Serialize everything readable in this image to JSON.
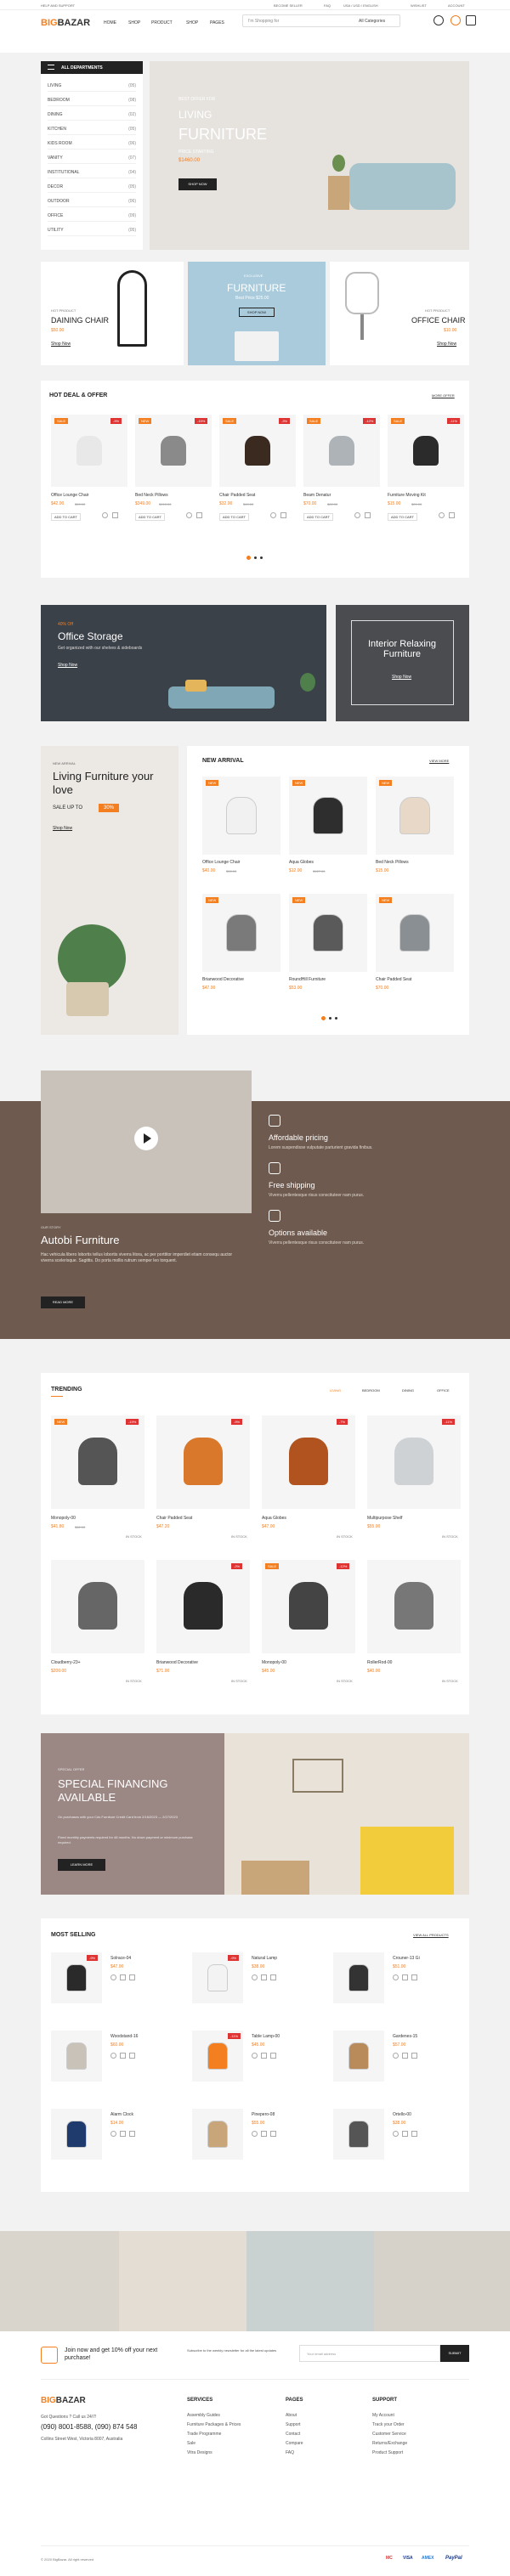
{
  "topbar": {
    "help": "HELP AND SUPPORT",
    "links": [
      "BECOME SELLER",
      "FAQ",
      "USA / USD / ENGLISH",
      "WISHLIST",
      "ACCOUNT"
    ]
  },
  "header": {
    "logo_a": "BIG",
    "logo_b": "BAZAR",
    "nav": [
      "HOME",
      "SHOP",
      "PRODUCT",
      "SHOP",
      "PAGES"
    ],
    "search_placeholder": "I'm Shopping for",
    "category": "All Categories"
  },
  "departments": {
    "title": "ALL DEPARTMENTS",
    "items": [
      {
        "name": "LIVING",
        "count": "(05)"
      },
      {
        "name": "BEDROOM",
        "count": "(08)"
      },
      {
        "name": "DINING",
        "count": "(02)"
      },
      {
        "name": "KITCHEN",
        "count": "(05)"
      },
      {
        "name": "KIDS ROOM",
        "count": "(06)"
      },
      {
        "name": "VANITY",
        "count": "(07)"
      },
      {
        "name": "INSTITUTIONAL",
        "count": "(04)"
      },
      {
        "name": "DECOR",
        "count": "(05)"
      },
      {
        "name": "OUTDOOR",
        "count": "(06)"
      },
      {
        "name": "OFFICE",
        "count": "(09)"
      },
      {
        "name": "UTILITY",
        "count": "(05)"
      }
    ]
  },
  "hero": {
    "kicker": "BEST OFFER FOR",
    "t1": "LIVING",
    "t2": "FURNITURE",
    "price_label": "PRICE STARTING",
    "price": "$1460.00",
    "btn": "SHOP NOW"
  },
  "promo3": [
    {
      "kicker": "HOT PRODUCT",
      "title": "DAINING CHAIR",
      "price": "$50.00",
      "link": "Shop Now"
    },
    {
      "kicker": "EXCLUSIVE",
      "title": "FURNITURE",
      "sub": "Best Price $25.00",
      "link": "SHOP NOW"
    },
    {
      "kicker": "HOT PRODUCT",
      "title": "OFFICE CHAIR",
      "price": "$10.00",
      "link": "Shop Now"
    }
  ],
  "hotdeal": {
    "title": "HOT DEAL & OFFER",
    "more": "MORE OFFER",
    "add": "ADD TO CART",
    "products": [
      {
        "name": "Office Lounge Chair",
        "price": "$42.00",
        "old": "$50.00",
        "tag": "SALE",
        "disc": "-9%"
      },
      {
        "name": "Bed Neck Pillows",
        "price": "$349.00",
        "old": "$410.00",
        "tag": "NEW",
        "disc": "-15%"
      },
      {
        "name": "Chair Padded Seat",
        "price": "$32.00",
        "old": "$40.00",
        "tag": "SALE",
        "disc": "-3%"
      },
      {
        "name": "Beam Denatur",
        "price": "$70.00",
        "old": "$80.00",
        "tag": "SALE",
        "disc": "-12%"
      },
      {
        "name": "Furniture Moving Kit",
        "price": "$15.00",
        "old": "$21.00",
        "tag": "SALE",
        "disc": "-11%"
      }
    ]
  },
  "banner2": [
    {
      "kicker": "40% Off",
      "title": "Office Storage",
      "sub": "Get organized with our shelves & sideboards",
      "link": "Shop Now"
    },
    {
      "title": "Interior Relaxing Furniture",
      "link": "Shop Now"
    }
  ],
  "arrival_promo": {
    "kicker": "NEW ARRIVAL",
    "title": "Living Furniture your love",
    "sale": "SALE UP TO",
    "pct": "30%",
    "link": "Shop Now"
  },
  "arrivals": {
    "title": "NEW ARRIVAL",
    "more": "VIEW MORE",
    "items": [
      {
        "name": "Office Lounge Chair",
        "price": "$40.00",
        "old": "$55.00",
        "tag": "NEW"
      },
      {
        "name": "Aqua Globes",
        "price": "$12.00",
        "old": "$127.00",
        "tag": "NEW"
      },
      {
        "name": "Bed Neck Pillows",
        "price": "$15.00",
        "old": "",
        "tag": "NEW"
      },
      {
        "name": "Brianwood Decorative",
        "price": "$47.00",
        "old": "",
        "tag": "NEW"
      },
      {
        "name": "RoundHill Furniture",
        "price": "$53.00",
        "old": "",
        "tag": "NEW"
      },
      {
        "name": "Chair Padded Seat",
        "price": "$70.00",
        "old": "",
        "tag": "NEW"
      }
    ]
  },
  "story": {
    "kicker": "OUR STORY",
    "title": "Autobi Furniture",
    "text": "Hac vehicula libero lobortis tellus lobortis viverra litora, ac per porttitor imperdiet etiam consequ auctor viverra scelerisque. Sagittis. Do porta mollis rutrum semper leo torquent.",
    "btn": "READ MORE",
    "features": [
      {
        "title": "Affordable pricing",
        "text": "Lorem suspendisse vulputate parturient gravida finibus."
      },
      {
        "title": "Free shipping",
        "text": "Viverra pellentesque risus conscituteer nam purus."
      },
      {
        "title": "Options available",
        "text": "Viverra pellentesque risus conscituteer nam purus."
      }
    ]
  },
  "trending": {
    "title": "TRENDING",
    "tabs": [
      "LIVING",
      "BEDROOM",
      "DINING",
      "OFFICE"
    ],
    "instock": "IN STOCK",
    "items": [
      {
        "name": "Monopoly-00",
        "price": "$41.80",
        "old": "$62.00",
        "tag": "NEW",
        "disc": "-19%"
      },
      {
        "name": "Chair Padded Seat",
        "price": "$47.20",
        "old": "",
        "tag": "",
        "disc": "-9%"
      },
      {
        "name": "Aqua Globes",
        "price": "$47.00",
        "old": "",
        "tag": "",
        "disc": "-7%"
      },
      {
        "name": "Multipurpose Shelf",
        "price": "$55.00",
        "old": "",
        "tag": "",
        "disc": "-11%"
      },
      {
        "name": "Cloudberry-23+",
        "price": "$200.00",
        "old": "",
        "tag": "",
        "disc": ""
      },
      {
        "name": "Brianwood Decorative",
        "price": "$71.00",
        "old": "",
        "tag": "",
        "disc": "-2%"
      },
      {
        "name": "Monopoly-00",
        "price": "$45.00",
        "old": "",
        "tag": "SALE",
        "disc": "-12%"
      },
      {
        "name": "RollerRod-00",
        "price": "$40.00",
        "old": "",
        "tag": "",
        "disc": ""
      }
    ]
  },
  "financing": {
    "kicker": "SPECIAL OFFER",
    "title": "SPECIAL FINANCING AVAILABLE",
    "text1": "On purchases with your Cds Furniture Credit Card from 2/16/2023 — 2/27/2023",
    "text2": "Fixed monthly payments required for 48 months. No down payment or minimum purchase required.",
    "btn": "LEARN MORE"
  },
  "mostselling": {
    "title": "MOST SELLING",
    "more": "VIEW ALL PRODUCTS",
    "items": [
      {
        "name": "Solrace-04",
        "price": "$47.00",
        "disc": "-9%"
      },
      {
        "name": "Natural Lamp",
        "price": "$38.00",
        "disc": "-9%"
      },
      {
        "name": "Crouner-13 Gi",
        "price": "$51.00",
        "disc": ""
      },
      {
        "name": "Woodstand-16",
        "price": "$60.00",
        "disc": ""
      },
      {
        "name": "Table Lamp-00",
        "price": "$45.00",
        "disc": "-11%"
      },
      {
        "name": "Gardenes-15",
        "price": "$57.00",
        "disc": ""
      },
      {
        "name": "Alarm Clock",
        "price": "$14.00",
        "disc": ""
      },
      {
        "name": "Pinepero-08",
        "price": "$55.00",
        "disc": ""
      },
      {
        "name": "Ortello-00",
        "price": "$38.00",
        "disc": ""
      }
    ]
  },
  "newsletter": {
    "join": "Join now and get 10% off your next purchase!",
    "sub": "Subscribe to the weekly newsletter for all the latest updates",
    "placeholder": "Your email address",
    "btn": "SUBMIT"
  },
  "footer": {
    "question": "Got Questions ? Call us 24/7!",
    "phones": "(090) 8001-8588, (090) 874 548",
    "address": "Collins Street West, Victoria 8007, Australia",
    "cols": [
      {
        "title": "SERVICES",
        "items": [
          "Assembly Guides",
          "Furniture Packages & Prices",
          "Trade Programme",
          "Sale",
          "Vitra Designs"
        ]
      },
      {
        "title": "PAGES",
        "items": [
          "About",
          "Support",
          "Contact",
          "Compare",
          "FAQ"
        ]
      },
      {
        "title": "SUPPORT",
        "items": [
          "My Account",
          "Track your Order",
          "Customer Service",
          "Returns/Exchange",
          "Product Support"
        ]
      }
    ],
    "copyright": "© 2020 BigBazar. All right reserved",
    "payments": [
      "MC",
      "VISA",
      "AMEX",
      "PayPal"
    ]
  },
  "colors": {
    "accent": "#f47f20",
    "brown": "#6e5a4e"
  }
}
